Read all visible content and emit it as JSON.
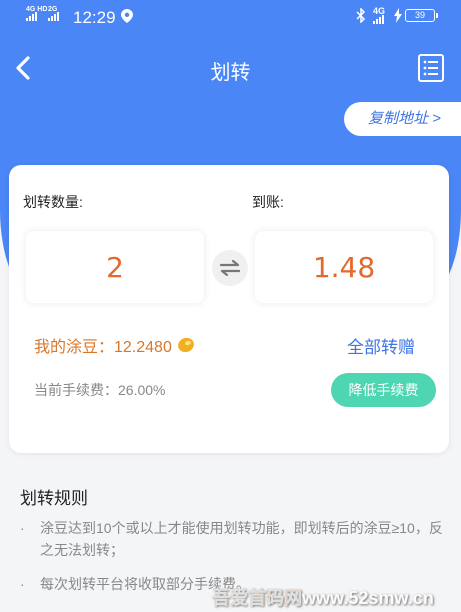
{
  "status_bar": {
    "net1": "4G HD",
    "net2": "2G",
    "time": "12:29",
    "net3": "4G",
    "battery": "39"
  },
  "header": {
    "title": "划转"
  },
  "copy_address_label": "复制地址 >",
  "card": {
    "amount_label": "划转数量:",
    "received_label": "到账:",
    "amount_value": "2",
    "received_value": "1.48",
    "beans_text": "我的涂豆：12.2480",
    "give_all_label": "全部转赠",
    "fee_text": "当前手续费：26.00%",
    "reduce_fee_label": "降低手续费"
  },
  "rules": {
    "title": "划转规则",
    "items": [
      "涂豆达到10个或以上才能使用划转功能，即划转后的涂豆≥10，反之无法划转；",
      "每次划转平台将收取部分手续费。"
    ]
  },
  "watermark": {
    "text_cn": "吾爱首码网",
    "text_url": "www.52smw.cn"
  },
  "colors": {
    "brand_blue": "#4a86f5",
    "accent_orange": "#e5692a",
    "button_teal": "#4dd6b1",
    "link_blue": "#3e74e6"
  }
}
